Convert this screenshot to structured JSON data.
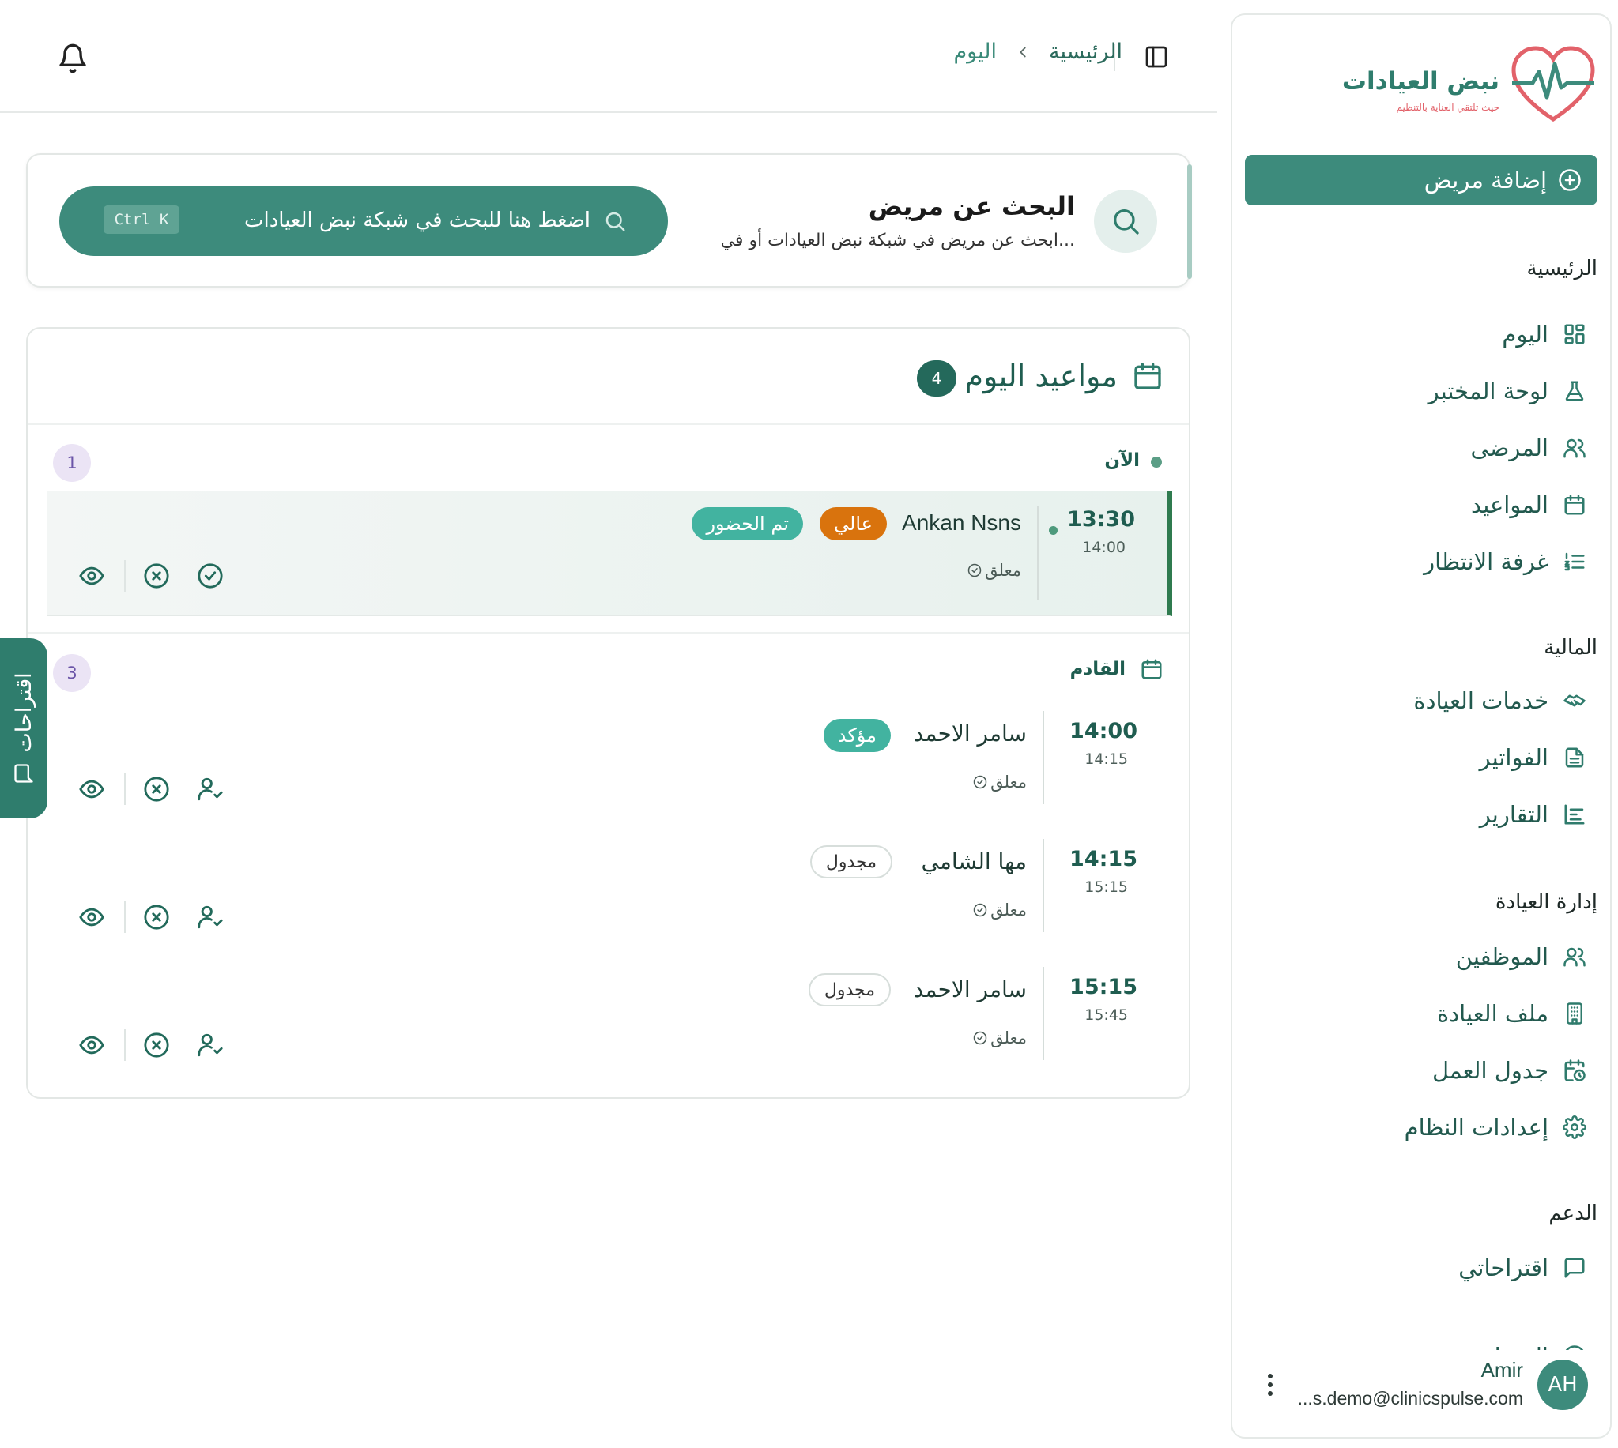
{
  "brand": {
    "name": "نبض العيادات",
    "tagline": "حيث تلتقي العناية بالتنظيم",
    "primary_color": "#3d8b7c",
    "logo_accent": "#e2626a"
  },
  "sidebar": {
    "add_patient": "إضافة مريض",
    "sections": [
      {
        "title": "الرئيسية",
        "items": [
          {
            "label": "اليوم",
            "icon": "grid-icon"
          },
          {
            "label": "لوحة المختبر",
            "icon": "flask-icon"
          },
          {
            "label": "المرضى",
            "icon": "users-icon"
          },
          {
            "label": "المواعيد",
            "icon": "calendar-icon"
          },
          {
            "label": "غرفة الانتظار",
            "icon": "list-ordered-icon"
          }
        ]
      },
      {
        "title": "المالية",
        "items": [
          {
            "label": "خدمات العيادة",
            "icon": "handshake-icon"
          },
          {
            "label": "الفواتير",
            "icon": "invoice-icon"
          },
          {
            "label": "التقارير",
            "icon": "bar-chart-icon"
          }
        ]
      },
      {
        "title": "إدارة العيادة",
        "items": [
          {
            "label": "الموظفين",
            "icon": "users-icon"
          },
          {
            "label": "ملف العيادة",
            "icon": "building-icon"
          },
          {
            "label": "جدول العمل",
            "icon": "calendar-clock-icon"
          },
          {
            "label": "إعدادات النظام",
            "icon": "gear-icon"
          }
        ]
      },
      {
        "title": "الدعم",
        "items": [
          {
            "label": "اقتراحاتي",
            "icon": "message-icon"
          },
          {
            "label": "المساعدة",
            "icon": "help-icon"
          }
        ]
      }
    ],
    "user": {
      "initials": "AH",
      "name": "Amir",
      "email": "...s.demo@clinicspulse.com"
    }
  },
  "header": {
    "breadcrumb": [
      "الرئيسية",
      "اليوم"
    ]
  },
  "search": {
    "title": "البحث عن مريض",
    "subtitle": "ابحث عن مريض في شبكة نبض العيادات أو في...",
    "placeholder": "اضغط هنا للبحث في شبكة نبض العيادات",
    "shortcut": "Ctrl K"
  },
  "appointments": {
    "title": "مواعيد اليوم",
    "total": "4",
    "now": {
      "label": "الآن",
      "count": "1",
      "items": [
        {
          "start": "13:30",
          "end": "14:00",
          "name": "Ankan Nsns",
          "priority": "عالي",
          "badge": "تم الحضور",
          "status": "معلق"
        }
      ]
    },
    "upcoming": {
      "label": "القادم",
      "count": "3",
      "items": [
        {
          "start": "14:00",
          "end": "14:15",
          "name": "سامر الاحمد",
          "badge": "مؤكد",
          "status": "معلق"
        },
        {
          "start": "14:15",
          "end": "15:15",
          "name": "مها الشامي",
          "badge": "مجدول",
          "status": "معلق"
        },
        {
          "start": "15:15",
          "end": "15:45",
          "name": "سامر الاحمد",
          "badge": "مجدول",
          "status": "معلق"
        }
      ]
    }
  },
  "suggestions_tab": "اقتراحات"
}
